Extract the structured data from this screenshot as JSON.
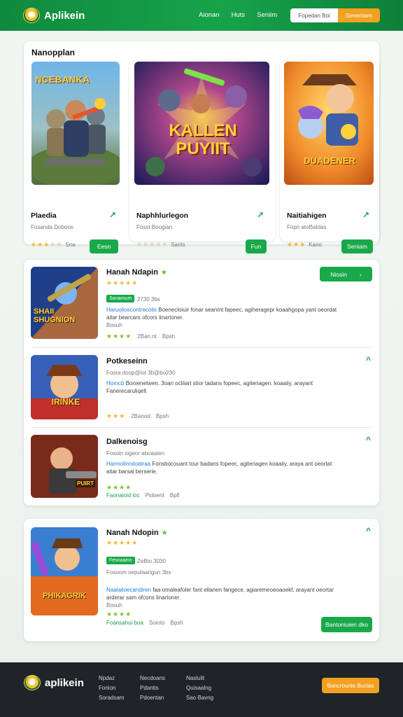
{
  "header": {
    "logo_text": "Aplikein",
    "nav": [
      "Aionan",
      "Huts",
      "Seniim"
    ],
    "search_placeholder": "Fopedan Boi",
    "search_button": "Seneniam"
  },
  "featured": {
    "title": "Nanopplan",
    "cards": [
      {
        "art_title": "NCEBANKA",
        "title": "Plaedia",
        "sub": "Fosanda Doboos",
        "rating_text": "Sna",
        "rating": 3,
        "button": "Eesn"
      },
      {
        "art_title": "KALLEN PUYIIT",
        "title": "Naphhlurlegon",
        "sub": "Fosst Boogian",
        "rating_text": "Sants",
        "rating": 0,
        "button": "Fun"
      },
      {
        "art_title": "DUADENER",
        "title": "Naitiahigen",
        "sub": "Fopn atoBatdas",
        "rating_text": "Kano",
        "rating": 3,
        "button": "Seniam"
      }
    ]
  },
  "list": {
    "rows": [
      {
        "art_title": "SHAII SHUGNION",
        "title": "Hanah Ndapin",
        "verified": true,
        "tag": "Sanaroum",
        "meta": "2730 3bs",
        "desc_hl": "Haruolioscontrecolis",
        "desc": "Boenecloiuir fonar seanmt fapeec, agiheragepr koaahgopa yant oeordat aitar bearcars ofcors linartoner.",
        "desc_tail": "Bosuh",
        "rating": 4,
        "footer_a": "2Ban.nt",
        "footer_b": "Bpsh",
        "button": "Niosin"
      },
      {
        "art_title": "IRINKE",
        "title": "Potkeseinn",
        "meta": "Fosra doop@lot 3b@bo230",
        "desc_hl": "Homcb",
        "desc": "Bonienetwen. 3oan ocliiart stior tadans fopeec, agiteriagen. koaaiiy, arayant Fanerecaruliqelt",
        "rating": 3,
        "footer_a": "2Banod",
        "footer_b": "Bpsh"
      },
      {
        "art_title": "PUIRT",
        "title": "Dalkenoisg",
        "meta": "Fosoin sigeor aboaaien",
        "desc_hl": "Harmolinnitoatraa",
        "desc": "Fonsbocouant tour badans fopeec, agiteriagen koaaiiy, araya ant oeortat aitar barsal berserie.",
        "rating": 4,
        "footer_tag": "Faonaioid loc",
        "footer_a": "Pidoent",
        "footer_b": "Bpfl"
      }
    ]
  },
  "single": {
    "art_title": "PHIKAGRIK",
    "title": "Nanah Ndopin",
    "verified": true,
    "tag": "Fesnaaino",
    "meta": "ZeBio 3030",
    "sub": "Fosoom oepulaarigun 3bs",
    "desc_hl": "Naalailoecandiren",
    "desc": "faa omaleafoler fant ellanen fangece, agiaremeoeoaoekf, arayant oeortar arderar sam ofcons linartoner.",
    "desc_tail": "Bosuh",
    "rating": 4,
    "footer_tag": "Foansahui boa",
    "footer_a": "Soioto",
    "footer_b": "Bpsh",
    "button": "Bantoniuien dko"
  },
  "footer": {
    "logo_text": "aplikein",
    "col1": [
      "Npdaz",
      "Fonion",
      "Soradsam"
    ],
    "col2": [
      "Necdoans",
      "Pdantis",
      "Pdoentan"
    ],
    "col3": [
      "Naslulit",
      "Quisaalng",
      "Sao Bavng"
    ],
    "button": "Bancrounia Bucias"
  },
  "colors": {
    "brand_green": "#17a34a",
    "accent_orange": "#f4a020",
    "star_gold": "#f2b632",
    "footer_bg": "#1f2428"
  }
}
